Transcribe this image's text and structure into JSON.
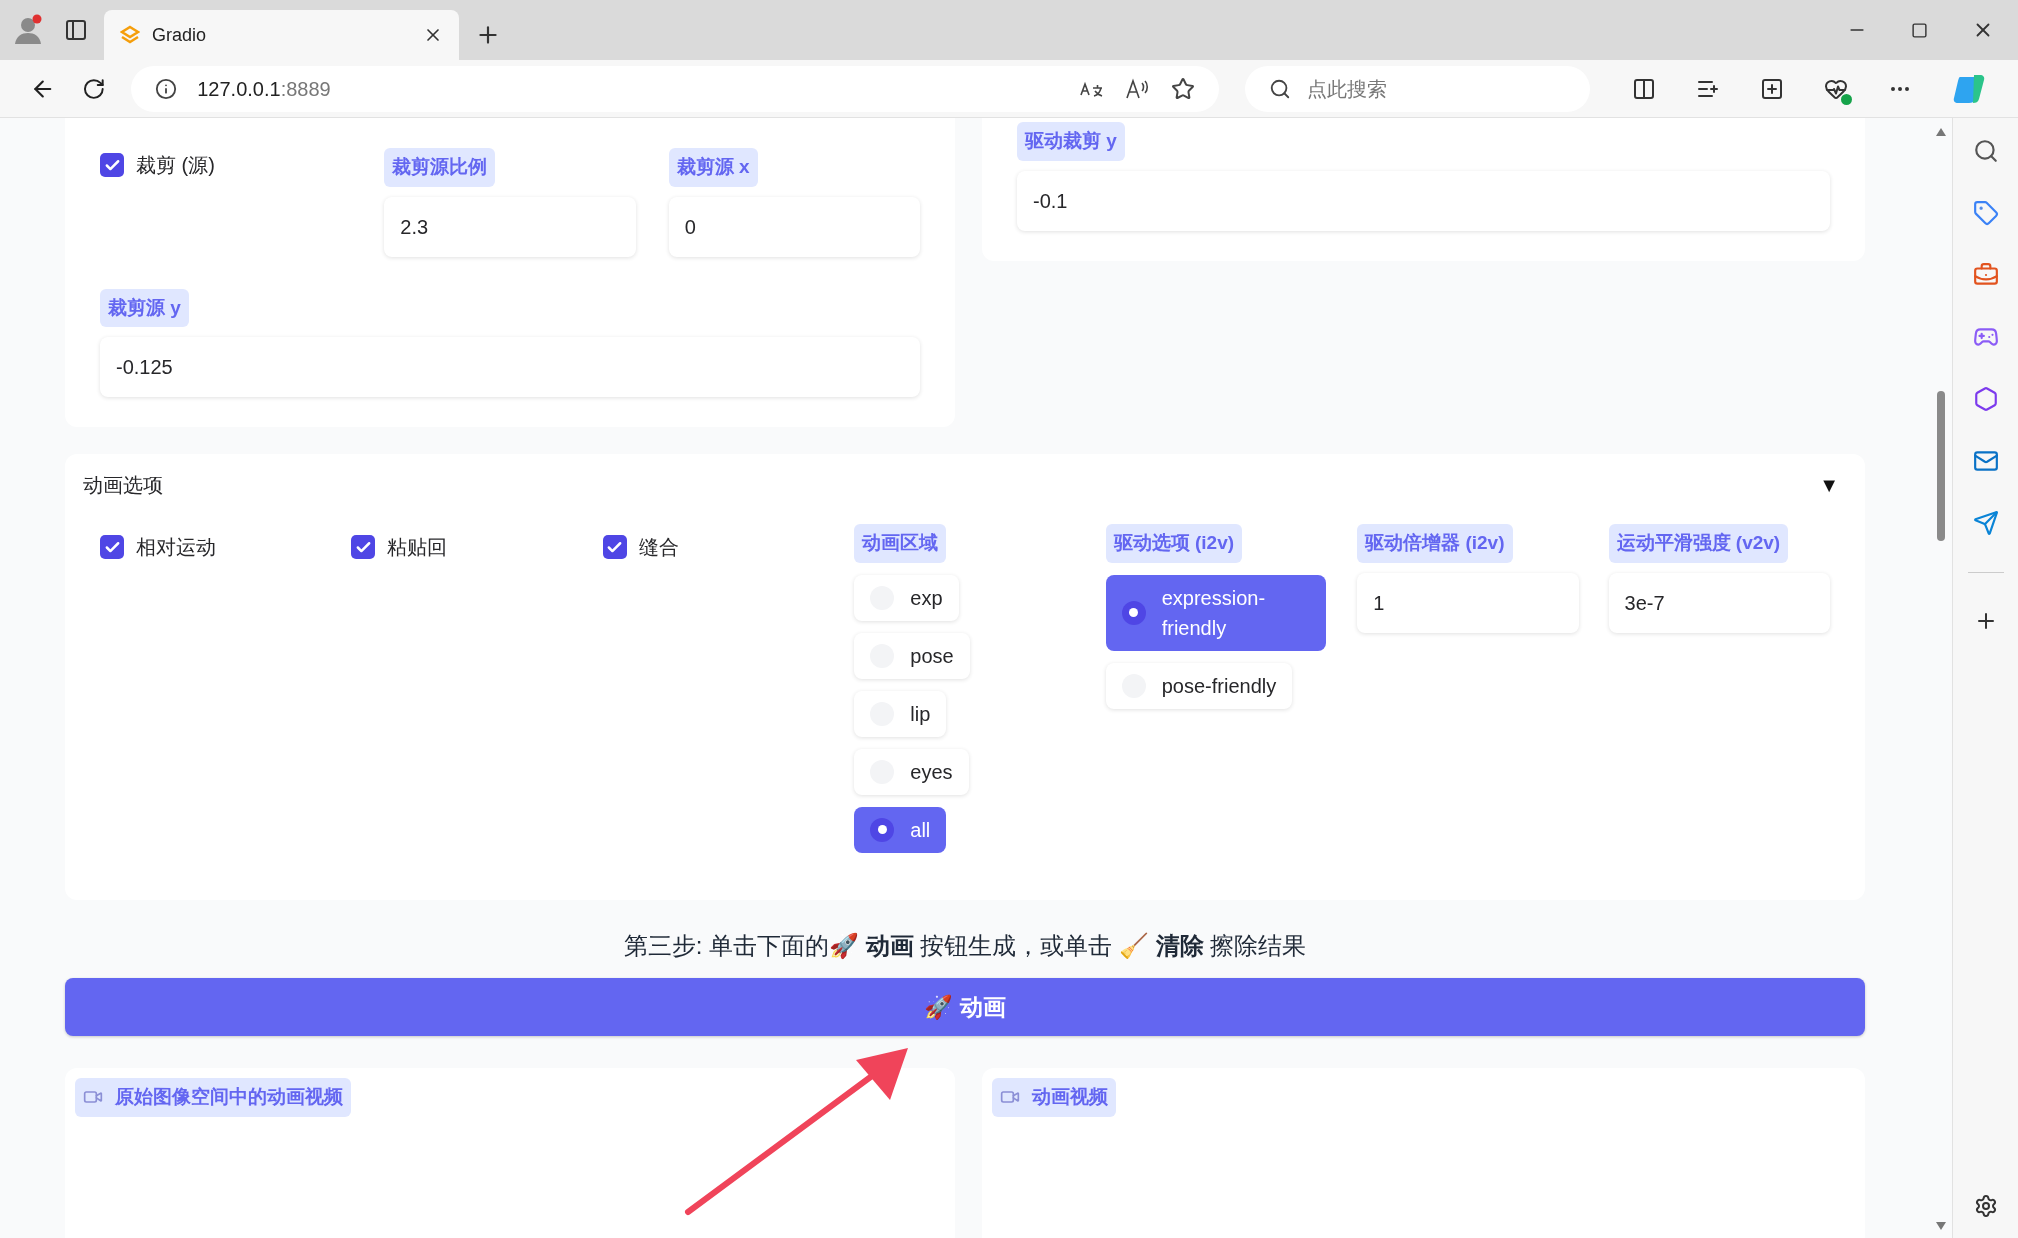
{
  "browser": {
    "tab_title": "Gradio",
    "url_host": "127.0.0.1",
    "url_port": ":8889",
    "search_placeholder": "点此搜索"
  },
  "crop_panel": {
    "checkbox": {
      "label": "裁剪 (源)",
      "checked": true
    },
    "fields": [
      {
        "label": "裁剪源比例",
        "value": "2.3"
      },
      {
        "label": "裁剪源 x",
        "value": "0"
      },
      {
        "label": "裁剪源 y",
        "value": "-0.125"
      }
    ]
  },
  "drive_crop_panel": {
    "field": {
      "label": "驱动裁剪 y",
      "value": "-0.1"
    }
  },
  "animation_options": {
    "title": "动画选项",
    "toggle": "▼",
    "expanded": true,
    "checkboxes": [
      {
        "label": "相对运动",
        "checked": true
      },
      {
        "label": "粘贴回",
        "checked": true
      },
      {
        "label": "缝合",
        "checked": true
      }
    ],
    "radio_groups": [
      {
        "label": "动画区域",
        "options": [
          {
            "label": "exp",
            "selected": false
          },
          {
            "label": "pose",
            "selected": false
          },
          {
            "label": "lip",
            "selected": false
          },
          {
            "label": "eyes",
            "selected": false
          },
          {
            "label": "all",
            "selected": true
          }
        ]
      },
      {
        "label": "驱动选项 (i2v)",
        "options": [
          {
            "label": "expression-friendly",
            "selected": true
          },
          {
            "label": "pose-friendly",
            "selected": false
          }
        ]
      }
    ],
    "fields": [
      {
        "label": "驱动倍增器 (i2v)",
        "value": "1"
      },
      {
        "label": "运动平滑强度 (v2v)",
        "value": "3e-7"
      }
    ]
  },
  "instruction": "第三步: 单击下面的🚀 **动画** 按钮生成，或单击 🧹 **清除** 擦除结果",
  "animate_button": "🚀 动画",
  "outputs": [
    {
      "label": "原始图像空间中的动画视频"
    },
    {
      "label": "动画视频"
    }
  ]
}
